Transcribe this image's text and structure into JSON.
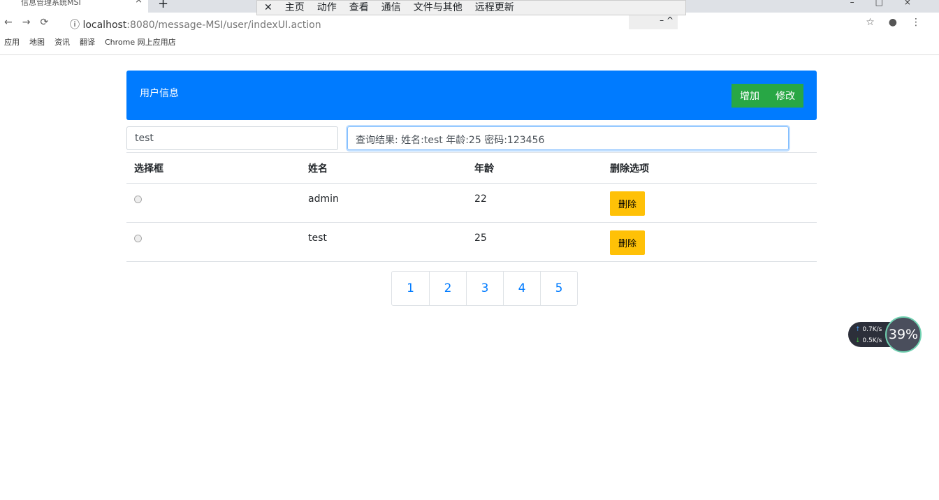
{
  "browser": {
    "tab_title": "信息管理系统MSI",
    "url_host": "localhost",
    "url_rest": ":8080/message-MSI/user/indexUI.action",
    "bookmarks": [
      "应用",
      "地图",
      "资讯",
      "翻译",
      "Chrome 网上应用店"
    ]
  },
  "remote_toolbar": [
    "主页",
    "动作",
    "查看",
    "通信",
    "文件与其他",
    "远程更新"
  ],
  "header": {
    "title": "用户信息",
    "add": "增加",
    "edit": "修改"
  },
  "search": {
    "value": "test",
    "result": "查询结果:  姓名:test  年龄:25  密码:123456"
  },
  "table": {
    "headers": [
      "选择框",
      "姓名",
      "年龄",
      "删除选项"
    ],
    "rows": [
      {
        "name": "admin",
        "age": "22",
        "action": "删除"
      },
      {
        "name": "test",
        "age": "25",
        "action": "删除"
      }
    ]
  },
  "pagination": [
    "1",
    "2",
    "3",
    "4",
    "5"
  ],
  "net": {
    "up": "0.7K/s",
    "down": "0.5K/s",
    "percent": "39%"
  }
}
